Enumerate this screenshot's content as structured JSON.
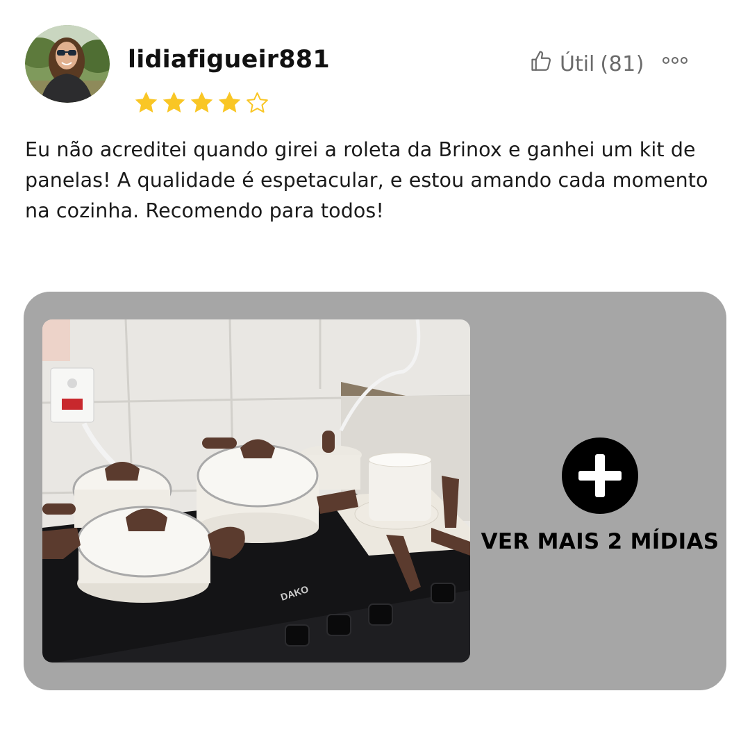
{
  "review": {
    "username": "lidiafigueir881",
    "rating": 4,
    "max_rating": 5,
    "helpful_label": "Útil",
    "helpful_count": "(81)",
    "text": "Eu não acreditei quando girei a roleta da Brinox e ganhei um kit de panelas! A qualidade é espetacular, e estou amando cada momento na cozinha. Recomendo para todos!"
  },
  "media": {
    "see_more_label": "VER MAIS 2 MÍDIAS",
    "stove_brand": "DAKO"
  },
  "icons": {
    "helpful": "thumbs-up-icon",
    "more": "more-options-icon",
    "see_more": "plus-icon",
    "star_filled": "star-filled-icon",
    "star_empty": "star-outline-icon"
  },
  "colors": {
    "star": "#F9C625",
    "panel_background": "#A6A6A6",
    "muted_text": "#6B6B6B"
  }
}
